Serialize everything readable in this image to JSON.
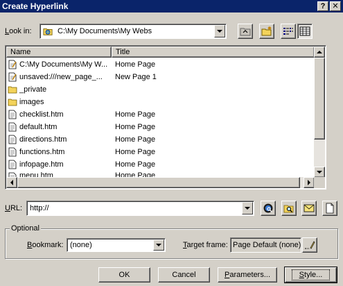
{
  "window": {
    "title": "Create Hyperlink",
    "help_label": "?",
    "close_label": "✕"
  },
  "look_in": {
    "label": "Look in:",
    "label_hotkey": "L",
    "label_rest": "ook in:",
    "value": "C:\\My Documents\\My Webs"
  },
  "toolbar": {
    "icons": [
      "folder-up-icon",
      "new-folder-icon",
      "list-view-icon",
      "details-view-icon"
    ]
  },
  "file_list": {
    "columns": [
      "Name",
      "Title"
    ],
    "rows": [
      {
        "name": "C:\\My Documents\\My W...",
        "title": "Home Page",
        "icon": "html-page-icon"
      },
      {
        "name": "unsaved:///new_page_...",
        "title": "New Page 1",
        "icon": "html-page-icon"
      },
      {
        "name": "_private",
        "title": "",
        "icon": "folder-icon"
      },
      {
        "name": "images",
        "title": "",
        "icon": "folder-icon"
      },
      {
        "name": "checklist.htm",
        "title": "Home Page",
        "icon": "document-icon"
      },
      {
        "name": "default.htm",
        "title": "Home Page",
        "icon": "document-icon"
      },
      {
        "name": "directions.htm",
        "title": "Home Page",
        "icon": "document-icon"
      },
      {
        "name": "functions.htm",
        "title": "Home Page",
        "icon": "document-icon"
      },
      {
        "name": "infopage.htm",
        "title": "Home Page",
        "icon": "document-icon"
      },
      {
        "name": "menu.htm",
        "title": "Home Page",
        "icon": "document-icon"
      }
    ]
  },
  "url": {
    "label": "URL:",
    "label_hotkey": "U",
    "label_rest": "RL:",
    "value": "http://",
    "icons": [
      "web-browse-icon",
      "file-browse-icon",
      "email-icon",
      "new-page-icon"
    ]
  },
  "optional": {
    "legend": "Optional",
    "bookmark_label": "Bookmark:",
    "bookmark_hotkey": "B",
    "bookmark_rest": "ookmark:",
    "bookmark_value": "(none)",
    "target_label": "Target frame:",
    "target_hotkey": "T",
    "target_rest": "arget frame:",
    "target_value": "Page Default (none)"
  },
  "buttons": {
    "ok": "OK",
    "cancel": "Cancel",
    "parameters": "Parameters...",
    "parameters_hotkey": "P",
    "parameters_rest": "arameters...",
    "style": "Style...",
    "style_hotkey": "S",
    "style_rest": "tyle..."
  },
  "colors": {
    "titlebar": "#0a246a",
    "face": "#d4d0c8",
    "window": "#ffffff"
  }
}
